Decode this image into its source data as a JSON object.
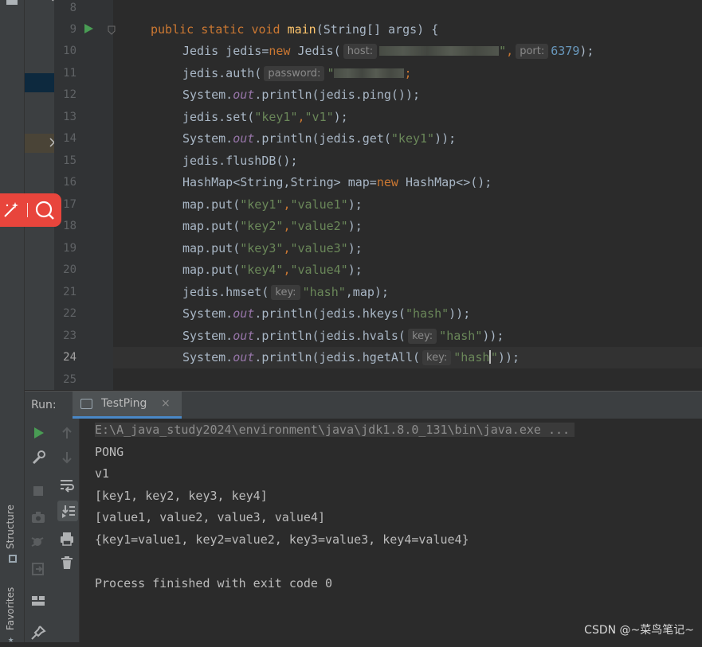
{
  "side_tabs": {
    "structure": "Structure",
    "favorites": "Favorites"
  },
  "editor": {
    "line_numbers": [
      "8",
      "9",
      "10",
      "11",
      "12",
      "13",
      "14",
      "15",
      "16",
      "17",
      "18",
      "19",
      "20",
      "21",
      "22",
      "23",
      "24",
      "25"
    ],
    "hints": {
      "host": "host:",
      "port": "port:",
      "password": "password:",
      "key": "key:"
    },
    "tokens": {
      "public": "public",
      "static": "static",
      "void": "void",
      "main": "main",
      "main_params": "(String[] args) {",
      "jedis_decl": "Jedis jedis=",
      "new": "new",
      "jedis_ctor": " Jedis(",
      "quote": "\"",
      "comma": ",",
      "port_val": "6379",
      "close_semi": ");",
      "semi": ";",
      "auth_call": "jedis.auth(",
      "sys": "System.",
      "out": "out",
      "println": ".println(",
      "ping_call": "jedis.ping());",
      "set_call": "jedis.set(",
      "key1": "\"key1\"",
      "v1": "\"v1\"",
      "get_call": "jedis.get(",
      "close2_semi": "));",
      "flush": "jedis.flushDB();",
      "hashmap_decl": "HashMap<String,String> map=",
      "hashmap_ctor": " HashMap<>();",
      "put": "map.put(",
      "key2": "\"key2\"",
      "key3": "\"key3\"",
      "key4": "\"key4\"",
      "value1": "\"value1\"",
      "value2": "\"value2\"",
      "value3": "\"value3\"",
      "value4": "\"value4\"",
      "hmset_call": "jedis.hmset(",
      "hash": "\"hash\"",
      "map_close": ",map);",
      "hkeys_call": "jedis.hkeys(",
      "hvals_call": "jedis.hvals(",
      "hgetall_call": "jedis.hgetAll(",
      "hash_open": "\"hash",
      "hash_close_q": "\"",
      "close3_semi": "));"
    }
  },
  "run_panel": {
    "label": "Run:",
    "tab_label": "TestPing",
    "close_glyph": "×",
    "console_lines": [
      "E:\\A_java_study2024\\environment\\java\\jdk1.8.0_131\\bin\\java.exe ...",
      "PONG",
      "v1",
      "[key1, key2, key3, key4]",
      "[value1, value2, value3, value4]",
      "{key1=value1, key2=value2, key3=value3, key4=value4}",
      "",
      "Process finished with exit code 0"
    ]
  },
  "watermark": "CSDN @~菜鸟笔记~",
  "colors": {
    "keyword": "#cc7832",
    "function": "#ffc66d",
    "string": "#6a8759",
    "number": "#6897bb",
    "field": "#9876aa",
    "run_green": "#499c54",
    "floating_bar": "#e8453c"
  }
}
